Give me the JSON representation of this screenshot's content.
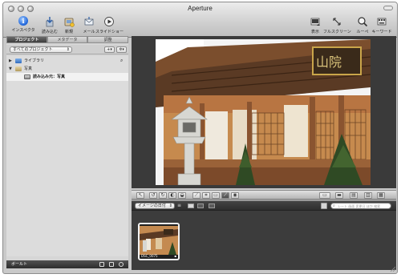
{
  "window": {
    "title": "Aperture"
  },
  "toolbar": {
    "left": [
      {
        "label": "インスペクタ",
        "icon": "info-icon"
      },
      {
        "label": "読み込む",
        "icon": "import-icon"
      },
      {
        "label": "新規",
        "icon": "new-icon"
      },
      {
        "label": "メール",
        "icon": "mail-icon"
      },
      {
        "label": "スライドショー",
        "icon": "slideshow-icon"
      }
    ],
    "right": [
      {
        "label": "表示",
        "icon": "view-icon"
      },
      {
        "label": "フルスクリーン",
        "icon": "fullscreen-icon"
      },
      {
        "label": "ルーペ",
        "icon": "loupe-icon"
      },
      {
        "label": "キーワード",
        "icon": "keyword-icon"
      }
    ]
  },
  "sidebar": {
    "tabs": [
      {
        "label": "プロジェクト",
        "active": true
      },
      {
        "label": "メタデータ",
        "active": false
      },
      {
        "label": "調整",
        "active": false
      }
    ],
    "project_filter": "すべてのプロジェクト",
    "tree": [
      {
        "label": "ライブラリ",
        "icon": "library-icon"
      },
      {
        "label": "写真",
        "icon": "folder-icon"
      },
      {
        "label": "読み込み元：写真",
        "icon": "project-icon"
      }
    ],
    "bottom_label": "ボールト"
  },
  "browser": {
    "sort_label": "イメージの日付",
    "filter_placeholder": "レート 画面 変更日 ほか 検索",
    "thumbnail_label": "DSC_0075"
  },
  "colors": {
    "toolbar_bg": "#cfcfcf",
    "viewer_bg": "#3a3a3a",
    "tab_active": "#4a4a4a",
    "selection": "#f2f2f2"
  }
}
